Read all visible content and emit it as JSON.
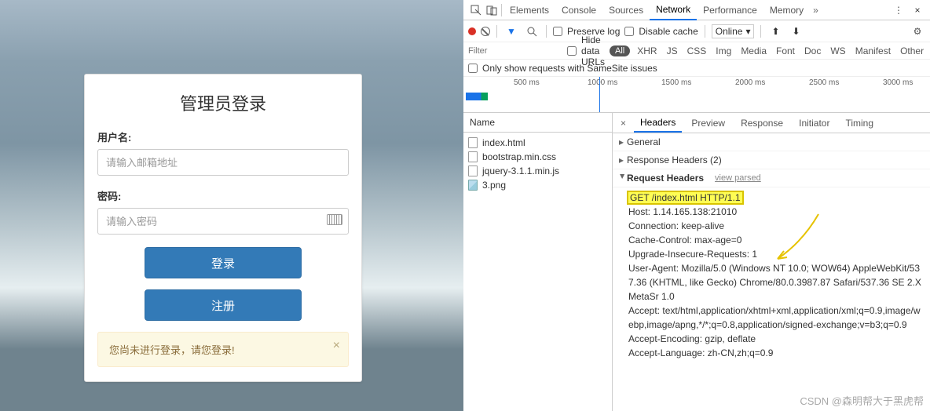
{
  "login": {
    "title": "管理员登录",
    "username_label": "用户名:",
    "username_placeholder": "请输入邮箱地址",
    "password_label": "密码:",
    "password_placeholder": "请输入密码",
    "login_btn": "登录",
    "register_btn": "注册",
    "alert_text": "您尚未进行登录，请您登录!"
  },
  "devtools": {
    "tabs": [
      "Elements",
      "Console",
      "Sources",
      "Network",
      "Performance",
      "Memory"
    ],
    "active_tab": "Network",
    "preserve_log": "Preserve log",
    "disable_cache": "Disable cache",
    "throttle": "Online",
    "filter_placeholder": "Filter",
    "hide_data_urls": "Hide data URLs",
    "filter_types": [
      "All",
      "XHR",
      "JS",
      "CSS",
      "Img",
      "Media",
      "Font",
      "Doc",
      "WS",
      "Manifest",
      "Other"
    ],
    "samesite": "Only show requests with SameSite issues",
    "timeline_ticks": [
      "500 ms",
      "1000 ms",
      "1500 ms",
      "2000 ms",
      "2500 ms",
      "3000 ms"
    ],
    "req_col": "Name",
    "requests": [
      {
        "name": "index.html",
        "type": "doc"
      },
      {
        "name": "bootstrap.min.css",
        "type": "doc"
      },
      {
        "name": "jquery-3.1.1.min.js",
        "type": "doc"
      },
      {
        "name": "3.png",
        "type": "img"
      }
    ],
    "detail_tabs": [
      "Headers",
      "Preview",
      "Response",
      "Initiator",
      "Timing"
    ],
    "active_detail": "Headers",
    "sections": {
      "general": "General",
      "response_headers": "Response Headers (2)",
      "request_headers": "Request Headers",
      "view_parsed": "view parsed"
    },
    "req_headers_lines": [
      "GET /index.html HTTP/1.1",
      "Host: 1.14.165.138:21010",
      "Connection: keep-alive",
      "Cache-Control: max-age=0",
      "Upgrade-Insecure-Requests: 1",
      "User-Agent: Mozilla/5.0 (Windows NT 10.0; WOW64) AppleWebKit/537.36 (KHTML, like Gecko) Chrome/80.0.3987.87 Safari/537.36 SE 2.X MetaSr 1.0",
      "Accept: text/html,application/xhtml+xml,application/xml;q=0.9,image/webp,image/apng,*/*;q=0.8,application/signed-exchange;v=b3;q=0.9",
      "Accept-Encoding: gzip, deflate",
      "Accept-Language: zh-CN,zh;q=0.9"
    ]
  },
  "watermark": "CSDN @森明帮大于黑虎帮"
}
